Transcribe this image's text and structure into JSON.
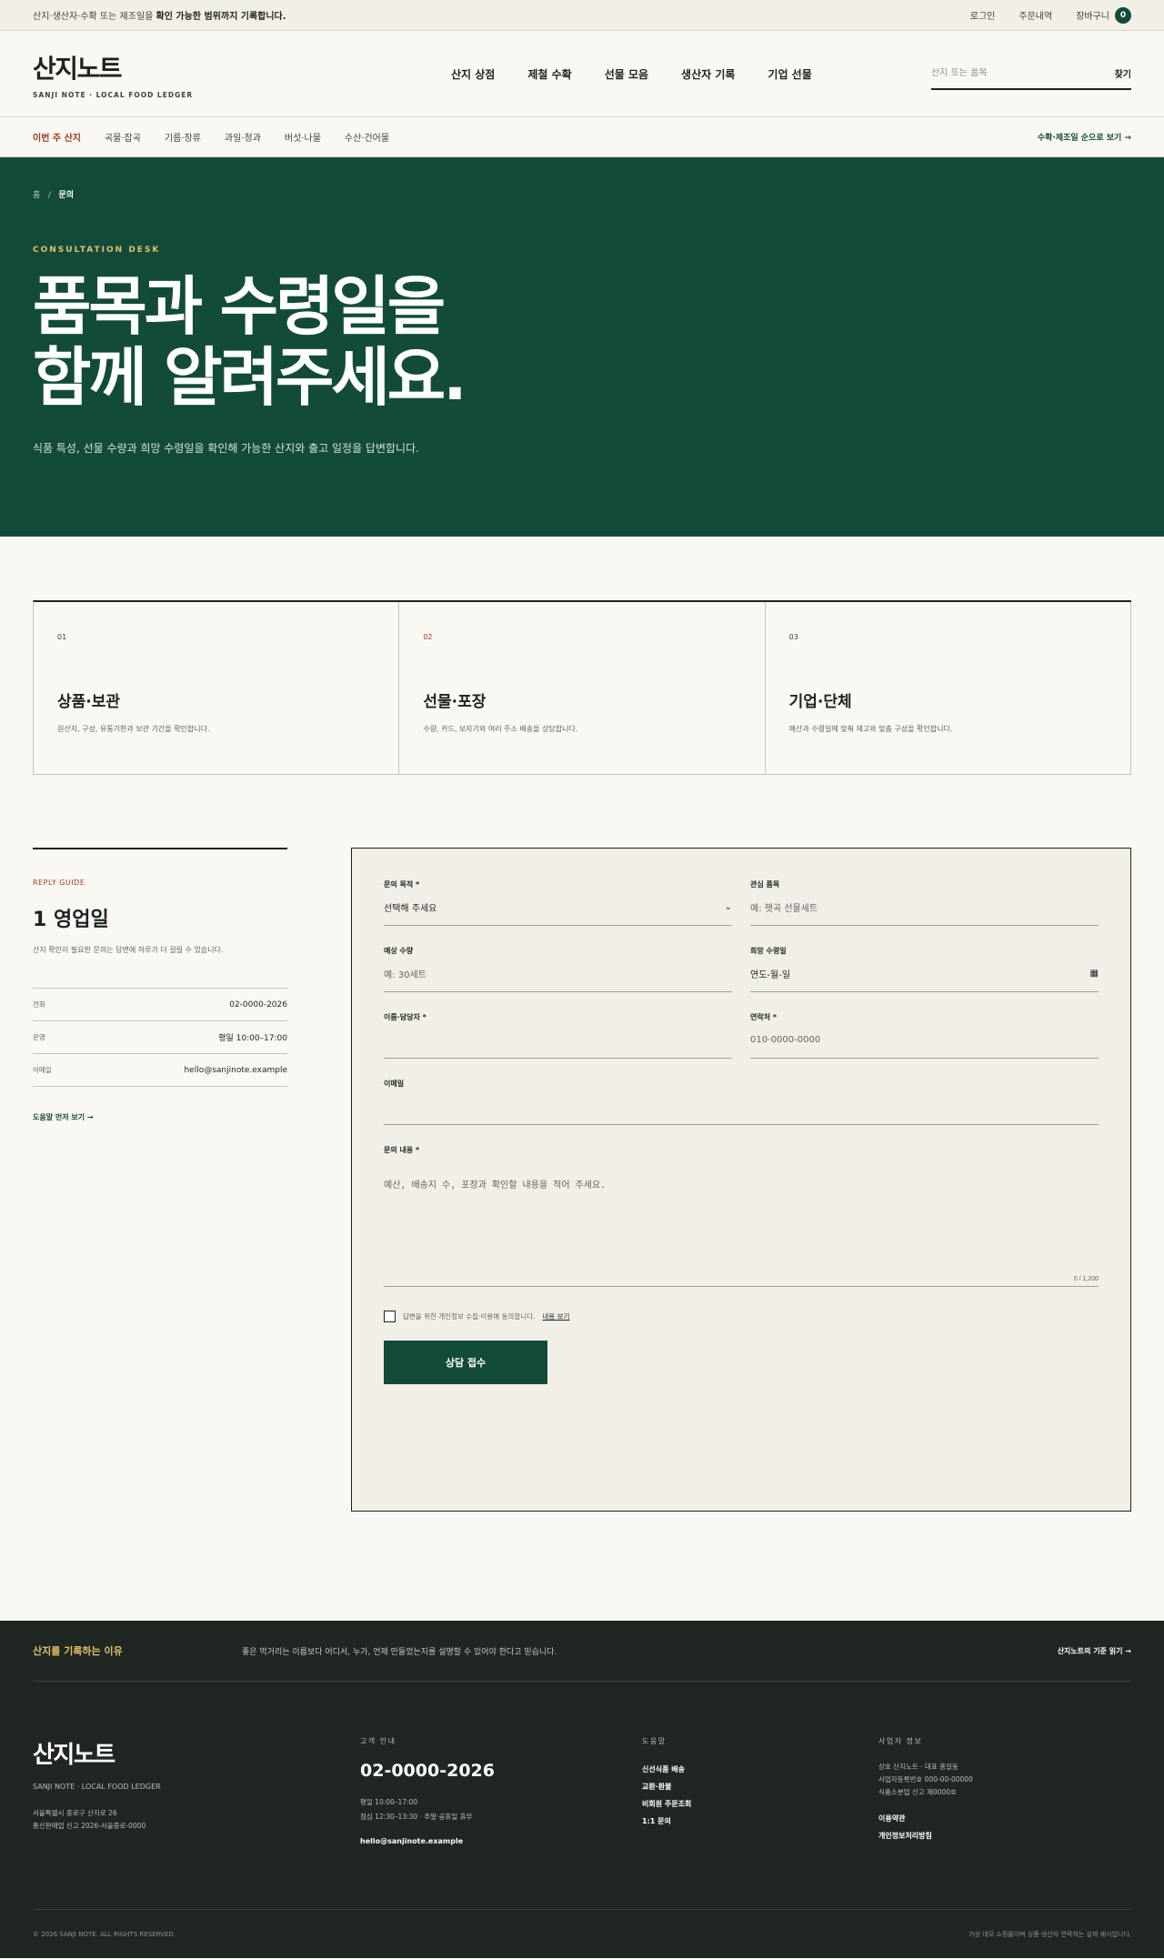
{
  "topbar": {
    "notice_plain": "산지·생산자·수확 또는 제조일을 ",
    "notice_bold": "확인 가능한 범위까지 기록합니다.",
    "login": "로그인",
    "orders": "주문내역",
    "cart": "장바구니",
    "cart_count": "0"
  },
  "header": {
    "logo": "산지노트",
    "logo_sub": "SANJI NOTE · LOCAL FOOD LEDGER",
    "nav": [
      "산지 상점",
      "제철 수확",
      "선물 모음",
      "생산자 기록",
      "기업 선물"
    ],
    "search_placeholder": "산지 또는 품목",
    "search_button": "찾기"
  },
  "subnav": {
    "items": [
      "이번 주 산지",
      "곡물·잡곡",
      "기름·장류",
      "과일·청과",
      "버섯·나물",
      "수산·건어물"
    ],
    "more": "수확·제조일 순으로 보기 →"
  },
  "hero": {
    "crumb_home": "홈",
    "crumb_sep": "/",
    "crumb_current": "문의",
    "eyebrow": "CONSULTATION DESK",
    "title_line1": "품목과 수령일을",
    "title_line2": "함께 알려주세요",
    "title_dot": ".",
    "desc": "식품 특성, 선물 수량과 희망 수령일을 확인해 가능한 산지와 출고 일정을 답변합니다."
  },
  "cards": [
    {
      "num": "01",
      "title": "상품·보관",
      "desc": "원산지, 구성, 유통기한과 보관 기간을 확인합니다."
    },
    {
      "num": "02",
      "title": "선물·포장",
      "desc": "수량, 카드, 보자기와 여러 주소 배송을 상담합니다."
    },
    {
      "num": "03",
      "title": "기업·단체",
      "desc": "예산과 수령일에 맞춰 재고와 맞춤 구성을 확인합니다."
    }
  ],
  "guide": {
    "label": "REPLY GUIDE",
    "title": "1 영업일",
    "desc": "산지 확인이 필요한 문의는 답변에 하루가 더 걸릴 수 있습니다.",
    "rows": [
      {
        "k": "전화",
        "v": "02-0000-2026"
      },
      {
        "k": "운영",
        "v": "평일 10:00–17:00"
      },
      {
        "k": "이메일",
        "v": "hello@sanjinote.example"
      }
    ],
    "link": "도움말 먼저 보기 →"
  },
  "form": {
    "purpose_label": "문의 목적 *",
    "purpose_value": "선택해 주세요",
    "item_label": "관심 품목",
    "item_placeholder": "예: 햇곡 선물세트",
    "qty_label": "예상 수량",
    "qty_placeholder": "예: 30세트",
    "date_label": "희망 수령일",
    "date_placeholder": "연도-월-일",
    "name_label": "이름·담당자 *",
    "name_placeholder": "",
    "phone_label": "연락처 *",
    "phone_placeholder": "010-0000-0000",
    "email_label": "이메일",
    "email_placeholder": "",
    "content_label": "문의 내용 *",
    "content_placeholder": "예산, 배송지 수, 포장과 확인할 내용을 적어 주세요.",
    "counter": "0 / 1,200",
    "consent_text": "답변을 위한 개인정보 수집·이용에 동의합니다.",
    "consent_link": "내용 보기",
    "submit": "상담 접수"
  },
  "footer": {
    "top_title": "산지를 기록하는 이유",
    "top_message": "좋은 먹거리는 이름보다 어디서, 누가, 언제 만들었는지를 설명할 수 있어야 한다고 믿습니다.",
    "top_link": "산지노트의 기준 읽기 →",
    "logo": "산지노트",
    "logo_sub": "SANJI NOTE · LOCAL FOOD LEDGER",
    "addr1": "서울특별시 중로구 산지로 26",
    "addr2": "통신판매업 신고 2026-서울중로-0000",
    "cs_title": "고객 안내",
    "cs_phone": "02-0000-2026",
    "cs_hours1": "평일 10:00–17:00",
    "cs_hours2": "점심 12:30–13:30 · 주말·공휴일 휴무",
    "cs_email": "hello@sanjinote.example",
    "help_title": "도움말",
    "help_links": [
      "신선식품 배송",
      "교환·환불",
      "비회원 주문조회",
      "1:1 문의"
    ],
    "biz_title": "사업자 정보",
    "biz1": "상호 산지노트 · 대표 홍길동",
    "biz2": "사업자등록번호 000-00-00000",
    "biz3": "식품소분업 신고 제0000호",
    "policy_links": [
      "이용약관",
      "개인정보처리방침"
    ],
    "copyright": "© 2026 SANJI NOTE. ALL RIGHTS RESERVED.",
    "bottom_note": "가상 데모 쇼핑몰이며 상품·생산자 연락처는 실제 예시입니다."
  },
  "colors": {
    "accent_green": "#134b3b",
    "accent_red": "#a13a22",
    "accent_gold": "#e0c268",
    "footer_bg": "#202723"
  }
}
